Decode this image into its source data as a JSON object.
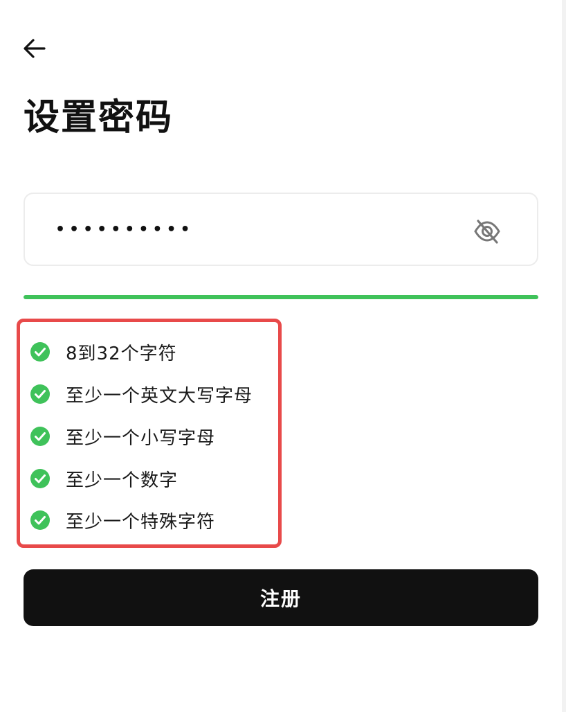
{
  "header": {
    "back_icon": "arrow-left-icon",
    "title": "设置密码"
  },
  "password": {
    "value": "••••••••••",
    "visibility_icon": "eye-off-icon",
    "strength_percent": 100,
    "strength_color": "#3fc25a"
  },
  "rules": {
    "box_color": "#e84a4a",
    "check_icon": "check-circle-icon",
    "check_color": "#3fc25a",
    "items": [
      {
        "label": "8到32个字符",
        "met": true
      },
      {
        "label": "至少一个英文大写字母",
        "met": true
      },
      {
        "label": "至少一个小写字母",
        "met": true
      },
      {
        "label": "至少一个数字",
        "met": true
      },
      {
        "label": "至少一个特殊字符",
        "met": true
      }
    ]
  },
  "actions": {
    "register_label": "注册",
    "register_color": "#111111"
  }
}
